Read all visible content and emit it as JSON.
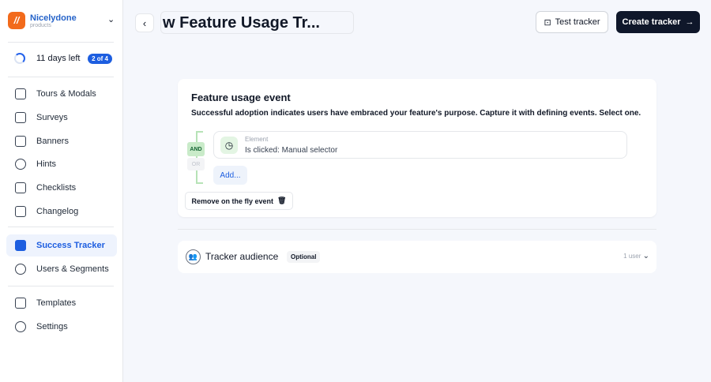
{
  "sidebar": {
    "brand": "Nicelydone",
    "sub": "products",
    "trial": "11 days left",
    "badge": "2 of 4",
    "items": [
      {
        "label": "Tours & Modals"
      },
      {
        "label": "Surveys"
      },
      {
        "label": "Banners"
      },
      {
        "label": "Hints"
      },
      {
        "label": "Checklists"
      },
      {
        "label": "Changelog"
      },
      {
        "label": "Success Tracker"
      },
      {
        "label": "Users & Segments"
      },
      {
        "label": "Templates"
      },
      {
        "label": "Settings"
      }
    ]
  },
  "header": {
    "title": "w Feature Usage Tr...",
    "test": "Test tracker",
    "create": "Create tracker"
  },
  "event": {
    "heading": "Feature usage event",
    "desc": "Successful adoption indicates users have embraced your feature's purpose. Capture it with defining events. Select one.",
    "and": "AND",
    "or": "OR",
    "element_label": "Element",
    "element_value": "Is clicked: Manual selector",
    "add": "Add...",
    "remove": "Remove on the fly event"
  },
  "audience": {
    "title": "Tracker audience",
    "optional": "Optional",
    "users": "1 user"
  }
}
